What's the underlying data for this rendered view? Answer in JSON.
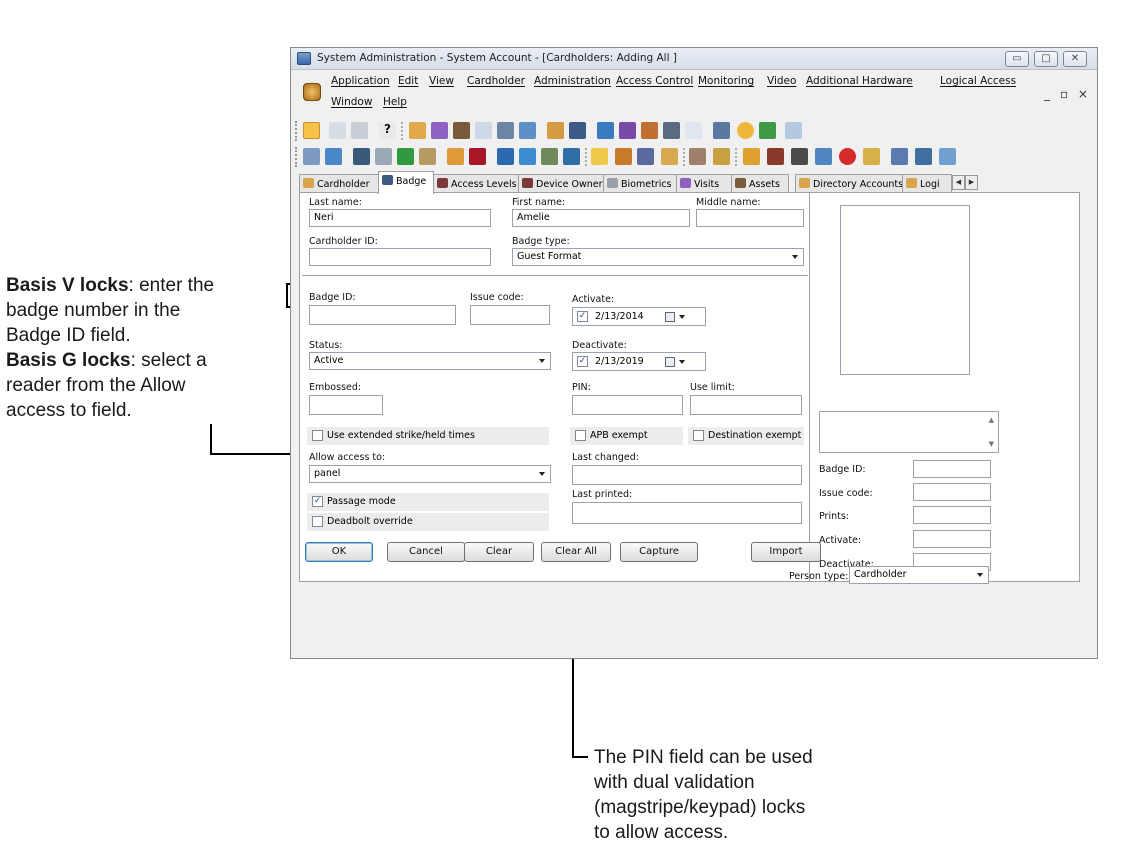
{
  "annotations": {
    "left_1_bold": "Basis V locks",
    "left_1_rest": ": enter the",
    "left_2": "badge number in the",
    "left_3": "Badge ID field.",
    "left_4_bold": "Basis G locks",
    "left_4_rest": ": select a",
    "left_5": "reader from the Allow",
    "left_6": "access to field.",
    "bottom_1": "The PIN field can be used",
    "bottom_2": "with dual validation",
    "bottom_3": "(magstripe/keypad) locks",
    "bottom_4": "to allow access."
  },
  "window": {
    "title": "System Administration - System Account - [Cardholders: Adding All ]",
    "minimize": "▭",
    "maximize": "□",
    "close": "✕",
    "mdi_controls": "_ ▫ ×"
  },
  "menu": {
    "row1": [
      "Application",
      "Edit",
      "View",
      "Cardholder",
      "Administration",
      "Access Control",
      "Monitoring",
      "Video",
      "Additional Hardware",
      "Logical Access"
    ],
    "row2": [
      "Window",
      "Help"
    ]
  },
  "tabs": [
    {
      "label": "Cardholder",
      "icon": "person-icon",
      "active": false
    },
    {
      "label": "Badge",
      "icon": "badge-icon",
      "active": true
    },
    {
      "label": "Access Levels",
      "icon": "door-icon",
      "active": false
    },
    {
      "label": "Device Owner",
      "icon": "door-icon",
      "active": false
    },
    {
      "label": "Biometrics",
      "icon": "fingerprint-icon",
      "active": false
    },
    {
      "label": "Visits",
      "icon": "visits-icon",
      "active": false
    },
    {
      "label": "Assets",
      "icon": "assets-icon",
      "active": false
    },
    {
      "label": "Directory Accounts",
      "icon": "person-icon",
      "active": false
    },
    {
      "label": "Logi",
      "icon": "person-icon",
      "active": false
    }
  ],
  "form": {
    "last_name_label": "Last name:",
    "last_name": "Neri",
    "first_name_label": "First name:",
    "first_name": "Amelie",
    "middle_name_label": "Middle name:",
    "middle_name": "",
    "cardholder_id_label": "Cardholder ID:",
    "cardholder_id": "",
    "badge_type_label": "Badge type:",
    "badge_type": "Guest Format",
    "badge_id_label": "Badge ID:",
    "badge_id": "",
    "issue_code_label": "Issue code:",
    "issue_code": "",
    "activate_label": "Activate:",
    "activate_date": "2/13/2014",
    "status_label": "Status:",
    "status": "Active",
    "deactivate_label": "Deactivate:",
    "deactivate_date": "2/13/2019",
    "embossed_label": "Embossed:",
    "embossed": "",
    "pin_label": "PIN:",
    "pin": "",
    "use_limit_label": "Use limit:",
    "use_limit": "",
    "use_extended_label": "Use extended strike/held times",
    "use_extended_checked": false,
    "apb_exempt_label": "APB exempt",
    "apb_exempt_checked": false,
    "destination_exempt_label": "Destination exempt",
    "destination_exempt_checked": false,
    "allow_access_label": "Allow access to:",
    "allow_access": "panel",
    "last_changed_label": "Last changed:",
    "last_changed": "",
    "passage_mode_label": "Passage mode",
    "passage_mode_checked": true,
    "last_printed_label": "Last printed:",
    "last_printed": "",
    "deadbolt_label": "Deadbolt override",
    "deadbolt_checked": false
  },
  "right_panel": {
    "badge_id_label": "Badge ID:",
    "issue_code_label": "Issue code:",
    "prints_label": "Prints:",
    "activate_label": "Activate:",
    "deactivate_label": "Deactivate:"
  },
  "buttons": {
    "ok": "OK",
    "cancel": "Cancel",
    "clear": "Clear",
    "clear_all": "Clear All",
    "capture": "Capture",
    "import": "Import"
  },
  "person_type": {
    "label": "Person type:",
    "value": "Cardholder"
  },
  "colors": {
    "window_bg": "#f0f0f0",
    "panel_bg": "#ffffff",
    "default_button_border": "#3c7fb1",
    "toolbar_highlight": "#f7c24a"
  }
}
